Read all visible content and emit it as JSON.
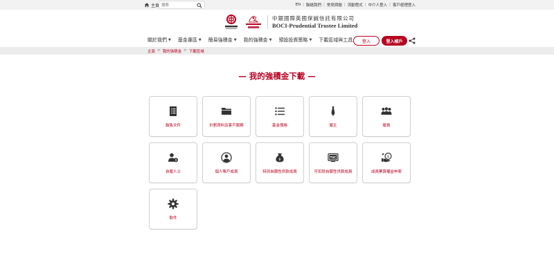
{
  "topbar": {
    "home_label": "主頁",
    "search_placeholder": "搜索",
    "links": [
      "EN",
      "聯絡我們",
      "常見問題",
      "流動程式",
      "中介人登入",
      "客戶經理登入"
    ]
  },
  "header": {
    "company_zh": "中銀國際英國保誠信託有限公司",
    "company_en": "BOCI-Prudential Trustee Limited"
  },
  "nav": {
    "items": [
      "關於我們",
      "基金專區",
      "簡易強積金",
      "我的強積金",
      "預設投資策略",
      "下載區域與工具"
    ],
    "login_label": "登入",
    "open_account_label": "登入帳戶"
  },
  "breadcrumb": [
    "主頁",
    "我的強積金",
    "下載區域"
  ],
  "page_title": "— 我的強積金下載 —",
  "tiles": [
    {
      "label": "銷售文件",
      "icon": "document-list-icon"
    },
    {
      "label": "計劃資料及客戶服務",
      "icon": "folder-icon"
    },
    {
      "label": "基金價格",
      "icon": "list-icon"
    },
    {
      "label": "僱主",
      "icon": "tie-icon"
    },
    {
      "label": "僱員",
      "icon": "group-icon"
    },
    {
      "label": "自僱人士",
      "icon": "person-dollar-icon"
    },
    {
      "label": "個人賬戶成員",
      "icon": "user-circle-icon"
    },
    {
      "label": "特別自願性供款成員",
      "icon": "money-bag-icon"
    },
    {
      "label": "可扣稅自願性供款成員",
      "icon": "tvc-icon"
    },
    {
      "label": "成員累算權益申索",
      "icon": "hand-coin-icon"
    },
    {
      "label": "軟件",
      "icon": "gear-icon"
    }
  ],
  "colors": {
    "brand_red": "#b8001f",
    "tile_border": "#cfcfcf",
    "bar_grey": "#ececec"
  }
}
